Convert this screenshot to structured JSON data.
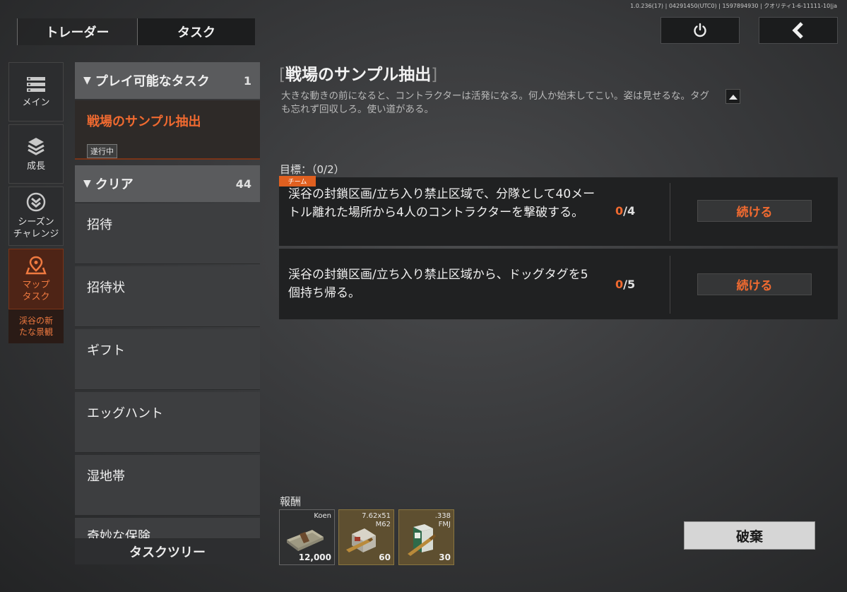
{
  "version_info": "1.0.236(17) | 04291450(UTC0) | 1597894930 | クオリティ1-6-11111-10|ja",
  "top_tabs": {
    "trader": "トレーダー",
    "task": "タスク"
  },
  "top_buttons": {
    "power": "power-icon",
    "back": "chevron-left-icon"
  },
  "side_nav": [
    {
      "label": "メイン",
      "icon": "list-icon"
    },
    {
      "label": "成長",
      "icon": "layers-icon"
    },
    {
      "label": "シーズン\nチャレンジ",
      "icon": "season-chevron-icon"
    },
    {
      "label": "マップ\nタスク",
      "icon": "map-pin-icon",
      "active": true
    }
  ],
  "side_sub_label": "渓谷の新\nたな景観",
  "task_list": {
    "playable": {
      "title": "プレイ可能なタスク",
      "count": "1"
    },
    "selected_task": {
      "name": "戦場のサンプル抽出",
      "status": "遂行中"
    },
    "cleared": {
      "title": "クリア",
      "count": "44"
    },
    "items": [
      "招待",
      "招待状",
      "ギフト",
      "エッグハント",
      "湿地帯",
      "奇妙な保険"
    ]
  },
  "task_tree_button": "タスクツリー",
  "detail": {
    "title": "戦場のサンプル抽出",
    "description": "大きな動きの前になると、コントラクターは活発になる。何人か始末してこい。姿は見せるな。タグも忘れず回収しろ。使い道がある。",
    "objective_label": "目標：（0/2）",
    "objectives": [
      {
        "tag": "チーム",
        "text": "渓谷の封鎖区画/立ち入り禁止区域で、分隊として40メートル離れた場所から4人のコントラクターを撃破する。",
        "current": "0",
        "total": "/4",
        "button": "続ける"
      },
      {
        "tag": "",
        "text": "渓谷の封鎖区画/立ち入り禁止区域から、ドッグタグを5個持ち帰る。",
        "current": "0",
        "total": "/5",
        "button": "続ける"
      }
    ],
    "reward_label": "報酬",
    "rewards": [
      {
        "name": "Koen",
        "qty": "12,000",
        "icon": "cash-bundle-icon"
      },
      {
        "name": "7.62x51\nM62",
        "qty": "60",
        "icon": "ammo-box-icon"
      },
      {
        "name": ".338\nFMJ",
        "qty": "30",
        "icon": "ammo-box-icon"
      }
    ],
    "discard_button": "破棄"
  },
  "colors": {
    "accent": "#f06a30",
    "active_nav": "#4e2416",
    "panel": "#202122"
  }
}
